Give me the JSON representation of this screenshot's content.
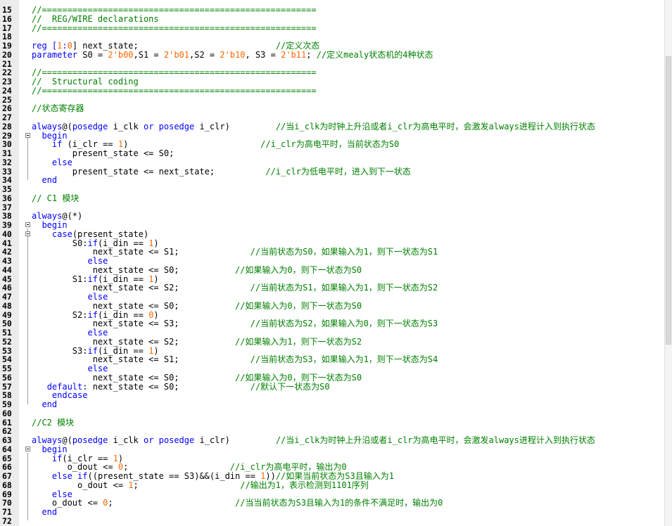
{
  "editor": {
    "lines": [
      {
        "n": "15",
        "fold": false,
        "segs": [
          {
            "t": "//======================================================",
            "c": "cm"
          }
        ]
      },
      {
        "n": "16",
        "fold": false,
        "segs": [
          {
            "t": "//  REG/WIRE declarations",
            "c": "cm"
          }
        ]
      },
      {
        "n": "17",
        "fold": false,
        "segs": [
          {
            "t": "//======================================================",
            "c": "cm"
          }
        ]
      },
      {
        "n": "18",
        "fold": false,
        "segs": []
      },
      {
        "n": "19",
        "fold": false,
        "segs": [
          {
            "t": "reg [",
            "c": "kw"
          },
          {
            "t": "1",
            "c": "num"
          },
          {
            "t": ":",
            "c": "kw"
          },
          {
            "t": "0",
            "c": "num"
          },
          {
            "t": "] next_state;                           ",
            "c": ""
          },
          {
            "t": "//定义次态",
            "c": "cm"
          }
        ]
      },
      {
        "n": "20",
        "fold": false,
        "segs": [
          {
            "t": "parameter",
            "c": "kw"
          },
          {
            "t": " S0 = ",
            "c": ""
          },
          {
            "t": "2'b00",
            "c": "num"
          },
          {
            "t": ",S1 = ",
            "c": ""
          },
          {
            "t": "2'b01",
            "c": "num"
          },
          {
            "t": ",S2 = ",
            "c": ""
          },
          {
            "t": "2'b10",
            "c": "num"
          },
          {
            "t": ", S3 = ",
            "c": ""
          },
          {
            "t": "2'b11",
            "c": "num"
          },
          {
            "t": "; ",
            "c": ""
          },
          {
            "t": "//定义mealy状态机的4种状态",
            "c": "cm"
          }
        ]
      },
      {
        "n": "21",
        "fold": false,
        "segs": []
      },
      {
        "n": "22",
        "fold": false,
        "segs": [
          {
            "t": "//======================================================",
            "c": "cm"
          }
        ]
      },
      {
        "n": "23",
        "fold": false,
        "segs": [
          {
            "t": "//  Structural coding",
            "c": "cm"
          }
        ]
      },
      {
        "n": "24",
        "fold": false,
        "segs": [
          {
            "t": "//======================================================",
            "c": "cm"
          }
        ]
      },
      {
        "n": "25",
        "fold": false,
        "segs": []
      },
      {
        "n": "26",
        "fold": false,
        "segs": [
          {
            "t": "//状态寄存器",
            "c": "cm"
          }
        ]
      },
      {
        "n": "27",
        "fold": false,
        "segs": []
      },
      {
        "n": "28",
        "fold": false,
        "segs": [
          {
            "t": "always",
            "c": "kw"
          },
          {
            "t": "@(",
            "c": ""
          },
          {
            "t": "posedge",
            "c": "kw"
          },
          {
            "t": " i_clk ",
            "c": ""
          },
          {
            "t": "or",
            "c": "kw"
          },
          {
            "t": " ",
            "c": ""
          },
          {
            "t": "posedge",
            "c": "kw"
          },
          {
            "t": " i_clr)         ",
            "c": ""
          },
          {
            "t": "//当i_clk为时钟上升沿或者i_clr为高电平时，会激发always进程计入到执行状态",
            "c": "cm"
          }
        ]
      },
      {
        "n": "29",
        "fold": true,
        "segs": [
          {
            "t": "  begin",
            "c": "kw"
          }
        ]
      },
      {
        "n": "30",
        "fold": false,
        "segs": [
          {
            "t": "    ",
            "c": ""
          },
          {
            "t": "if",
            "c": "kw"
          },
          {
            "t": " (i_clr == ",
            "c": ""
          },
          {
            "t": "1",
            "c": "num"
          },
          {
            "t": ")                          ",
            "c": ""
          },
          {
            "t": "//i_clr为高电平时，当前状态为S0",
            "c": "cm"
          }
        ]
      },
      {
        "n": "31",
        "fold": false,
        "segs": [
          {
            "t": "        present_state <= S0;",
            "c": ""
          }
        ]
      },
      {
        "n": "32",
        "fold": false,
        "segs": [
          {
            "t": "    ",
            "c": ""
          },
          {
            "t": "else",
            "c": "kw"
          }
        ]
      },
      {
        "n": "33",
        "fold": false,
        "segs": [
          {
            "t": "        present_state <= next_state;          ",
            "c": ""
          },
          {
            "t": "//i_clr为低电平时，进入到下一状态",
            "c": "cm"
          }
        ]
      },
      {
        "n": "34",
        "fold": false,
        "segs": [
          {
            "t": "  end",
            "c": "kw"
          }
        ]
      },
      {
        "n": "35",
        "fold": false,
        "segs": []
      },
      {
        "n": "36",
        "fold": false,
        "segs": [
          {
            "t": "// C1 模块",
            "c": "cm"
          }
        ]
      },
      {
        "n": "37",
        "fold": false,
        "segs": []
      },
      {
        "n": "38",
        "fold": false,
        "segs": [
          {
            "t": "always",
            "c": "kw"
          },
          {
            "t": "@(*)",
            "c": ""
          }
        ]
      },
      {
        "n": "39",
        "fold": true,
        "segs": [
          {
            "t": "  begin",
            "c": "kw"
          }
        ]
      },
      {
        "n": "40",
        "fold": true,
        "segs": [
          {
            "t": "    ",
            "c": ""
          },
          {
            "t": "case",
            "c": "kw"
          },
          {
            "t": "(present_state)",
            "c": ""
          }
        ]
      },
      {
        "n": "41",
        "fold": false,
        "segs": [
          {
            "t": "        S0:",
            "c": ""
          },
          {
            "t": "if",
            "c": "kw"
          },
          {
            "t": "(i_din == ",
            "c": ""
          },
          {
            "t": "1",
            "c": "num"
          },
          {
            "t": ")",
            "c": ""
          }
        ]
      },
      {
        "n": "42",
        "fold": false,
        "segs": [
          {
            "t": "            next_state <= S1;              ",
            "c": ""
          },
          {
            "t": "//当前状态为S0，如果输入为1，则下一状态为S1",
            "c": "cm"
          }
        ]
      },
      {
        "n": "43",
        "fold": false,
        "segs": [
          {
            "t": "           ",
            "c": ""
          },
          {
            "t": "else",
            "c": "kw"
          }
        ]
      },
      {
        "n": "44",
        "fold": false,
        "segs": [
          {
            "t": "            next_state <= S0;           ",
            "c": ""
          },
          {
            "t": "//如果输入为0，则下一状态为S0",
            "c": "cm"
          }
        ]
      },
      {
        "n": "45",
        "fold": false,
        "segs": [
          {
            "t": "        S1:",
            "c": ""
          },
          {
            "t": "if",
            "c": "kw"
          },
          {
            "t": "(i_din == ",
            "c": ""
          },
          {
            "t": "1",
            "c": "num"
          },
          {
            "t": ")",
            "c": ""
          }
        ]
      },
      {
        "n": "46",
        "fold": false,
        "segs": [
          {
            "t": "            next_state <= S2;              ",
            "c": ""
          },
          {
            "t": "//当前状态为S1，如果输入为1，则下一状态为S2",
            "c": "cm"
          }
        ]
      },
      {
        "n": "47",
        "fold": false,
        "segs": [
          {
            "t": "           ",
            "c": ""
          },
          {
            "t": "else",
            "c": "kw"
          }
        ]
      },
      {
        "n": "48",
        "fold": false,
        "segs": [
          {
            "t": "            next_state <= S0;           ",
            "c": ""
          },
          {
            "t": "//如果输入为0，则下一状态为S0",
            "c": "cm"
          }
        ]
      },
      {
        "n": "49",
        "fold": false,
        "segs": [
          {
            "t": "        S2:",
            "c": ""
          },
          {
            "t": "if",
            "c": "kw"
          },
          {
            "t": "(i_din == ",
            "c": ""
          },
          {
            "t": "0",
            "c": "num"
          },
          {
            "t": ")",
            "c": ""
          }
        ]
      },
      {
        "n": "50",
        "fold": false,
        "segs": [
          {
            "t": "            next_state <= S3;              ",
            "c": ""
          },
          {
            "t": "//当前状态为S2，如果输入为0，则下一状态为S3",
            "c": "cm"
          }
        ]
      },
      {
        "n": "51",
        "fold": false,
        "segs": [
          {
            "t": "           ",
            "c": ""
          },
          {
            "t": "else",
            "c": "kw"
          }
        ]
      },
      {
        "n": "52",
        "fold": false,
        "segs": [
          {
            "t": "            next_state <= S2;           ",
            "c": ""
          },
          {
            "t": "//如果输入为1，则下一状态为S2",
            "c": "cm"
          }
        ]
      },
      {
        "n": "53",
        "fold": false,
        "segs": [
          {
            "t": "        S3:",
            "c": ""
          },
          {
            "t": "if",
            "c": "kw"
          },
          {
            "t": "(i_din == ",
            "c": ""
          },
          {
            "t": "1",
            "c": "num"
          },
          {
            "t": ")",
            "c": ""
          }
        ]
      },
      {
        "n": "54",
        "fold": false,
        "segs": [
          {
            "t": "            next_state <= S1;              ",
            "c": ""
          },
          {
            "t": "//当前状态为S3，如果输入为1，则下一状态为S4",
            "c": "cm"
          }
        ]
      },
      {
        "n": "55",
        "fold": false,
        "segs": [
          {
            "t": "           ",
            "c": ""
          },
          {
            "t": "else",
            "c": "kw"
          }
        ]
      },
      {
        "n": "56",
        "fold": false,
        "segs": [
          {
            "t": "            next_state <= S0;           ",
            "c": ""
          },
          {
            "t": "//如果输入为0，则下一状态为S0",
            "c": "cm"
          }
        ]
      },
      {
        "n": "57",
        "fold": false,
        "segs": [
          {
            "t": "   ",
            "c": ""
          },
          {
            "t": "default",
            "c": "kw"
          },
          {
            "t": ": next_state <= S0;              ",
            "c": ""
          },
          {
            "t": "//默认下一状态为S0",
            "c": "cm"
          }
        ]
      },
      {
        "n": "58",
        "fold": false,
        "segs": [
          {
            "t": "    ",
            "c": ""
          },
          {
            "t": "endcase",
            "c": "kw"
          }
        ]
      },
      {
        "n": "59",
        "fold": false,
        "segs": [
          {
            "t": "  end",
            "c": "kw"
          }
        ]
      },
      {
        "n": "60",
        "fold": false,
        "segs": []
      },
      {
        "n": "61",
        "fold": false,
        "segs": [
          {
            "t": "//C2 模块",
            "c": "cm"
          }
        ]
      },
      {
        "n": "62",
        "fold": false,
        "segs": []
      },
      {
        "n": "63",
        "fold": false,
        "segs": [
          {
            "t": "always",
            "c": "kw"
          },
          {
            "t": "@(",
            "c": ""
          },
          {
            "t": "posedge",
            "c": "kw"
          },
          {
            "t": " i_clk ",
            "c": ""
          },
          {
            "t": "or",
            "c": "kw"
          },
          {
            "t": " ",
            "c": ""
          },
          {
            "t": "posedge",
            "c": "kw"
          },
          {
            "t": " i_clr)         ",
            "c": ""
          },
          {
            "t": "//当i_clk为时钟上升沿或者i_clr为高电平时，会激发always进程计入到执行状态",
            "c": "cm"
          }
        ]
      },
      {
        "n": "64",
        "fold": true,
        "segs": [
          {
            "t": "  begin",
            "c": "kw"
          }
        ]
      },
      {
        "n": "65",
        "fold": false,
        "segs": [
          {
            "t": "    ",
            "c": ""
          },
          {
            "t": "if",
            "c": "kw"
          },
          {
            "t": "(i_clr == ",
            "c": ""
          },
          {
            "t": "1",
            "c": "num"
          },
          {
            "t": ")",
            "c": ""
          }
        ]
      },
      {
        "n": "66",
        "fold": false,
        "segs": [
          {
            "t": "       o_dout <= ",
            "c": ""
          },
          {
            "t": "0",
            "c": "num"
          },
          {
            "t": ";                    ",
            "c": ""
          },
          {
            "t": "//i_clr为高电平时，输出为0",
            "c": "cm"
          }
        ]
      },
      {
        "n": "67",
        "fold": false,
        "segs": [
          {
            "t": "    ",
            "c": ""
          },
          {
            "t": "else",
            "c": "kw"
          },
          {
            "t": " ",
            "c": ""
          },
          {
            "t": "if",
            "c": "kw"
          },
          {
            "t": "((present_state == S3)&&(i_din == ",
            "c": ""
          },
          {
            "t": "1",
            "c": "num"
          },
          {
            "t": "))",
            "c": ""
          },
          {
            "t": "//如果当前状态为S3且输入为1",
            "c": "cm"
          }
        ]
      },
      {
        "n": "68",
        "fold": false,
        "segs": [
          {
            "t": "         o_dout <= ",
            "c": ""
          },
          {
            "t": "1",
            "c": "num"
          },
          {
            "t": ";                    ",
            "c": ""
          },
          {
            "t": "//输出为1，表示检测到1101序列",
            "c": "cm"
          }
        ]
      },
      {
        "n": "69",
        "fold": false,
        "segs": [
          {
            "t": "    ",
            "c": ""
          },
          {
            "t": "else",
            "c": "kw"
          }
        ]
      },
      {
        "n": "70",
        "fold": false,
        "segs": [
          {
            "t": "    o_dout <= ",
            "c": ""
          },
          {
            "t": "0",
            "c": "num"
          },
          {
            "t": ";                        ",
            "c": ""
          },
          {
            "t": "//当当前状态为S3且输入为1的条件不满足时，输出为0",
            "c": "cm"
          }
        ]
      },
      {
        "n": "71",
        "fold": false,
        "segs": [
          {
            "t": "  end",
            "c": "kw"
          }
        ]
      },
      {
        "n": "72",
        "fold": false,
        "segs": []
      }
    ]
  },
  "colors": {
    "keyword": "#0000ff",
    "number": "#ff6600",
    "comment": "#008000",
    "text": "#000000",
    "gutter": "#ececec"
  }
}
